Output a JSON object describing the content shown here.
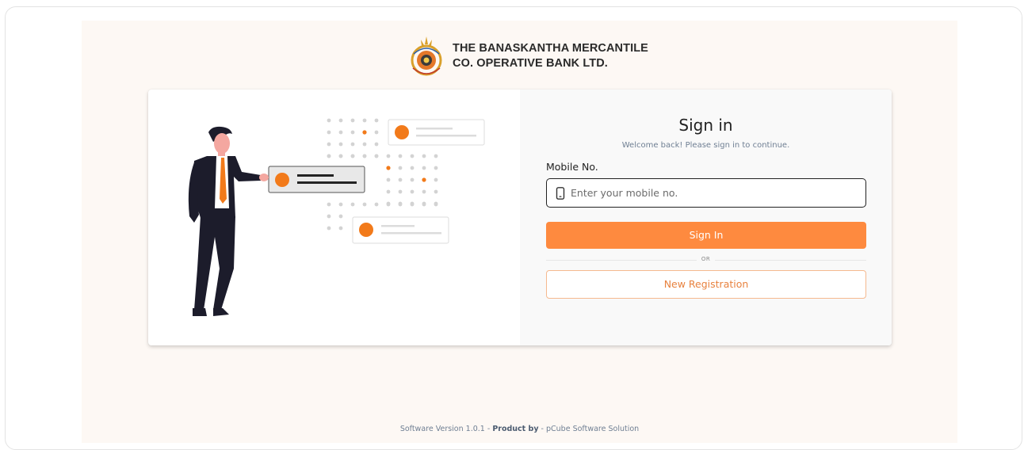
{
  "brand": {
    "name_line1": "THE BANASKANTHA MERCANTILE",
    "name_line2": "CO. OPERATIVE BANK LTD."
  },
  "signin": {
    "title": "Sign in",
    "subtitle": "Welcome back! Please sign in to continue.",
    "mobile_label": "Mobile No.",
    "mobile_value": "",
    "mobile_placeholder": "Enter your mobile no.",
    "signin_button": "Sign In",
    "divider": "OR",
    "register_button": "New Registration"
  },
  "footer": {
    "version": "Software Version 1.0.1 - ",
    "product_by": "Product by",
    "company": " - pCube Software Solution"
  },
  "colors": {
    "accent": "#fe8a3f",
    "page_bg": "#fdf8f4",
    "text_muted": "#6f7f93"
  },
  "icons": {
    "phone": "mobile-phone-icon",
    "logo": "bank-logo"
  }
}
